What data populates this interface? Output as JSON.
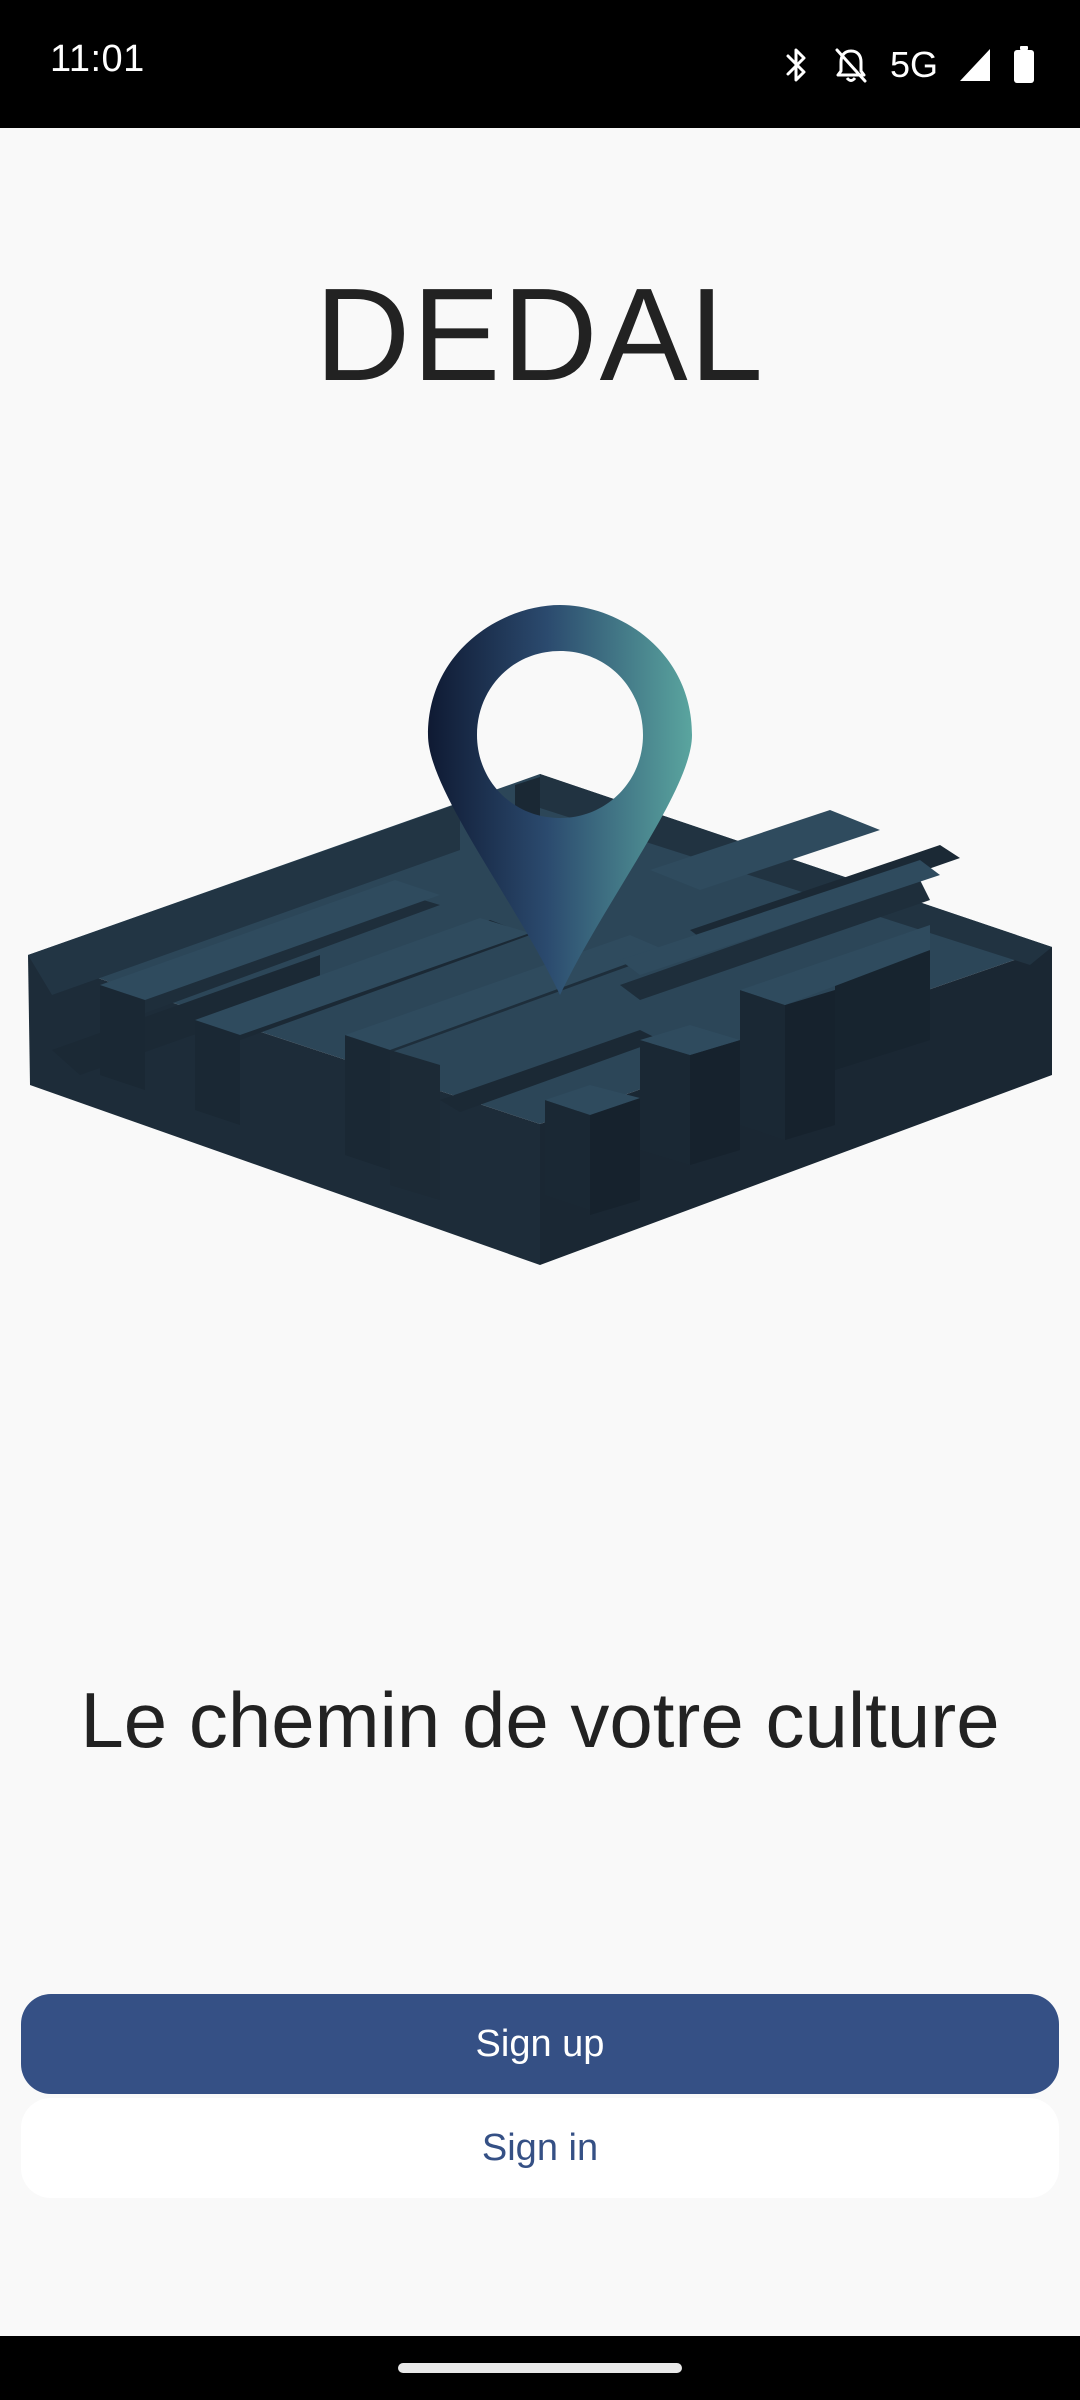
{
  "status_bar": {
    "time": "11:01",
    "network": "5G",
    "icons": [
      "bluetooth-icon",
      "notifications-off-icon",
      "signal-icon",
      "battery-icon"
    ]
  },
  "app": {
    "title": "DEDAL",
    "tagline": "Le chemin de votre culture"
  },
  "buttons": {
    "sign_up": "Sign up",
    "sign_in": "Sign in"
  },
  "colors": {
    "primary": "#355085",
    "background": "#f9f9f9",
    "maze_top": "#2c4658",
    "maze_side": "#1c2b38",
    "pin_gradient_start": "#0f1a33",
    "pin_gradient_end": "#5aa59f"
  }
}
